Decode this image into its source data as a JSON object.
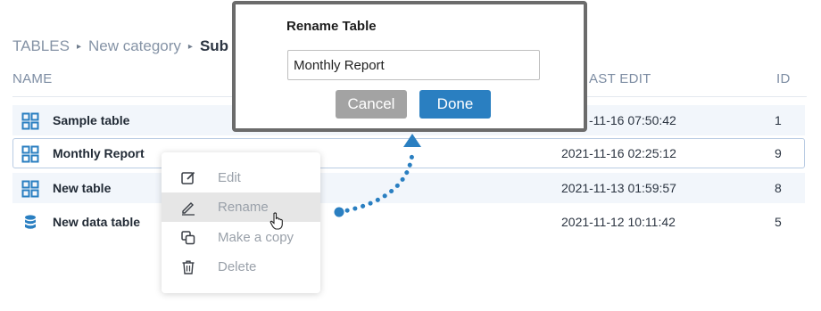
{
  "breadcrumb": {
    "root": "TABLES",
    "sep": "▸",
    "category": "New category",
    "current": "Sub"
  },
  "columns": {
    "name": "NAME",
    "last_edit": "AST EDIT",
    "id": "ID"
  },
  "rows": [
    {
      "name": "Sample table",
      "date": "-11-16 07:50:42",
      "id": "1",
      "icon": "table-grid-icon"
    },
    {
      "name": "Monthly Report",
      "date": "2021-11-16 02:25:12",
      "id": "9",
      "icon": "table-grid-icon"
    },
    {
      "name": "New table",
      "date": "2021-11-13 01:59:57",
      "id": "8",
      "icon": "table-grid-icon"
    },
    {
      "name": "New data table",
      "date": "2021-11-12 10:11:42",
      "id": "5",
      "icon": "database-icon"
    }
  ],
  "context_menu": {
    "items": [
      {
        "label": "Edit",
        "icon": "edit-icon"
      },
      {
        "label": "Rename",
        "icon": "pencil-icon"
      },
      {
        "label": "Make a copy",
        "icon": "copy-icon"
      },
      {
        "label": "Delete",
        "icon": "trash-icon"
      }
    ]
  },
  "dialog": {
    "title": "Rename Table",
    "input_value": "Monthly Report",
    "cancel_label": "Cancel",
    "done_label": "Done"
  },
  "colors": {
    "accent": "#2a7fc1",
    "icon_blue": "#2a7fc1",
    "muted_text": "#8593a6",
    "selected_border": "#b9cbe3",
    "dialog_border": "#6b6b6b"
  }
}
